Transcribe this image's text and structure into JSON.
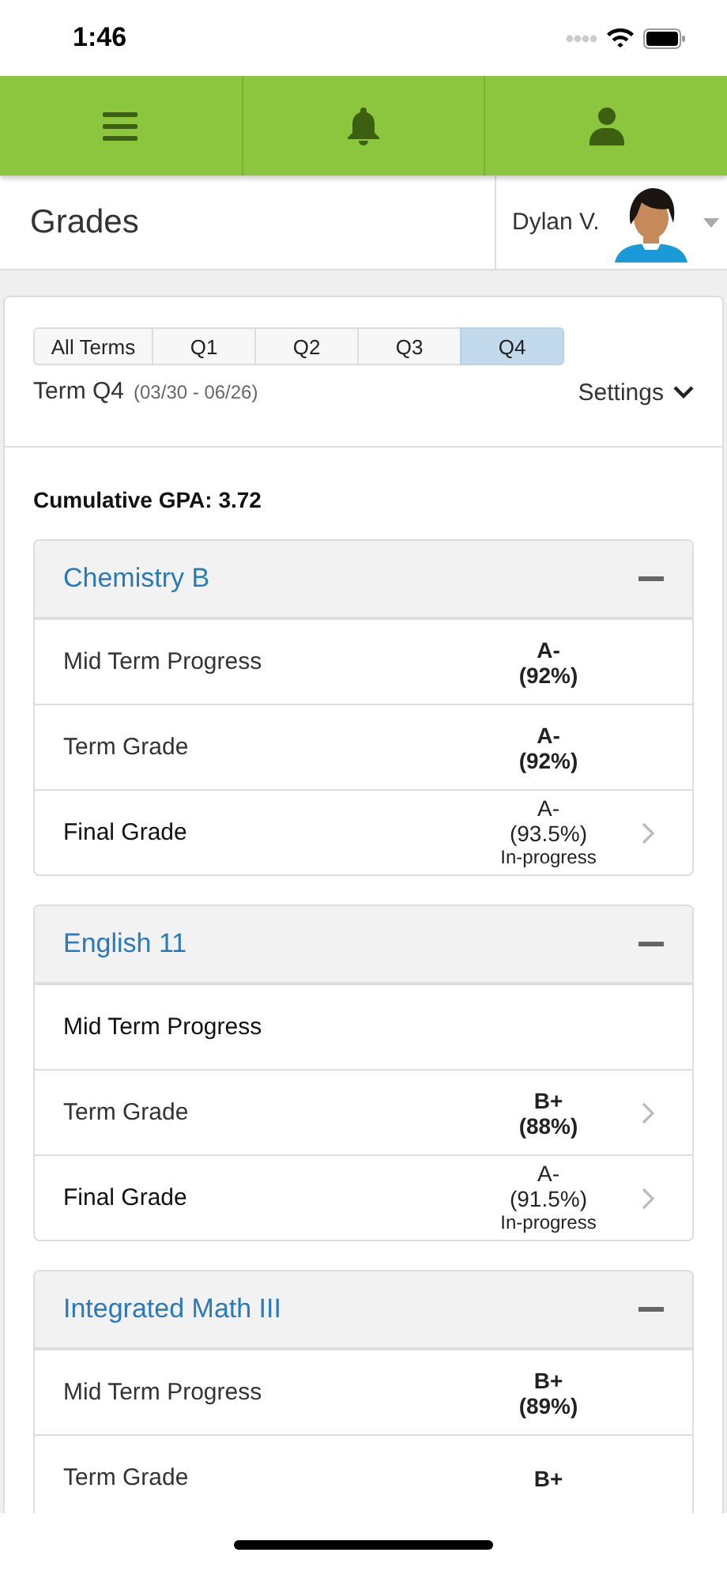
{
  "status_bar": {
    "time": "1:46"
  },
  "nav": [
    {
      "kind": "menu",
      "selected": false
    },
    {
      "kind": "bell",
      "selected": false
    },
    {
      "kind": "person",
      "selected": false
    }
  ],
  "header": {
    "title": "Grades",
    "student": "Dylan V."
  },
  "terms": [
    {
      "label": "All Terms",
      "selected": false
    },
    {
      "label": "Q1",
      "selected": false
    },
    {
      "label": "Q2",
      "selected": false
    },
    {
      "label": "Q3",
      "selected": false
    },
    {
      "label": "Q4",
      "selected": true
    }
  ],
  "term": {
    "name": "Term Q4",
    "dates": "(03/30 - 06/26)",
    "settings": "Settings"
  },
  "gpa": "Cumulative GPA: 3.72",
  "courses": [
    {
      "name": "Chemistry B",
      "expanded": true,
      "rows": [
        {
          "label": "Mid Term Progress",
          "grade": "A-",
          "percent": "(92%)",
          "bold": true,
          "chevron": false
        },
        {
          "label": "Term Grade",
          "grade": "A-",
          "percent": "(92%)",
          "bold": true,
          "chevron": false
        },
        {
          "label": "Final Grade",
          "grade": "A-",
          "percent": "(93.5%)",
          "bold": false,
          "note": "In-progress",
          "chevron": true
        }
      ]
    },
    {
      "name": "English 11",
      "expanded": true,
      "rows": [
        {
          "label": "Mid Term Progress",
          "bold": false,
          "chevron": false
        },
        {
          "label": "Term Grade",
          "grade": "B+",
          "percent": "(88%)",
          "bold": true,
          "chevron": true
        },
        {
          "label": "Final Grade",
          "grade": "A-",
          "percent": "(91.5%)",
          "bold": false,
          "note": "In-progress",
          "chevron": true
        }
      ]
    },
    {
      "name": "Integrated Math III",
      "expanded": true,
      "rows": [
        {
          "label": "Mid Term Progress",
          "grade": "B+",
          "percent": "(89%)",
          "bold": true,
          "chevron": false
        },
        {
          "label": "Term Grade",
          "grade": "B+",
          "bold": true,
          "chevron": false
        }
      ]
    }
  ]
}
